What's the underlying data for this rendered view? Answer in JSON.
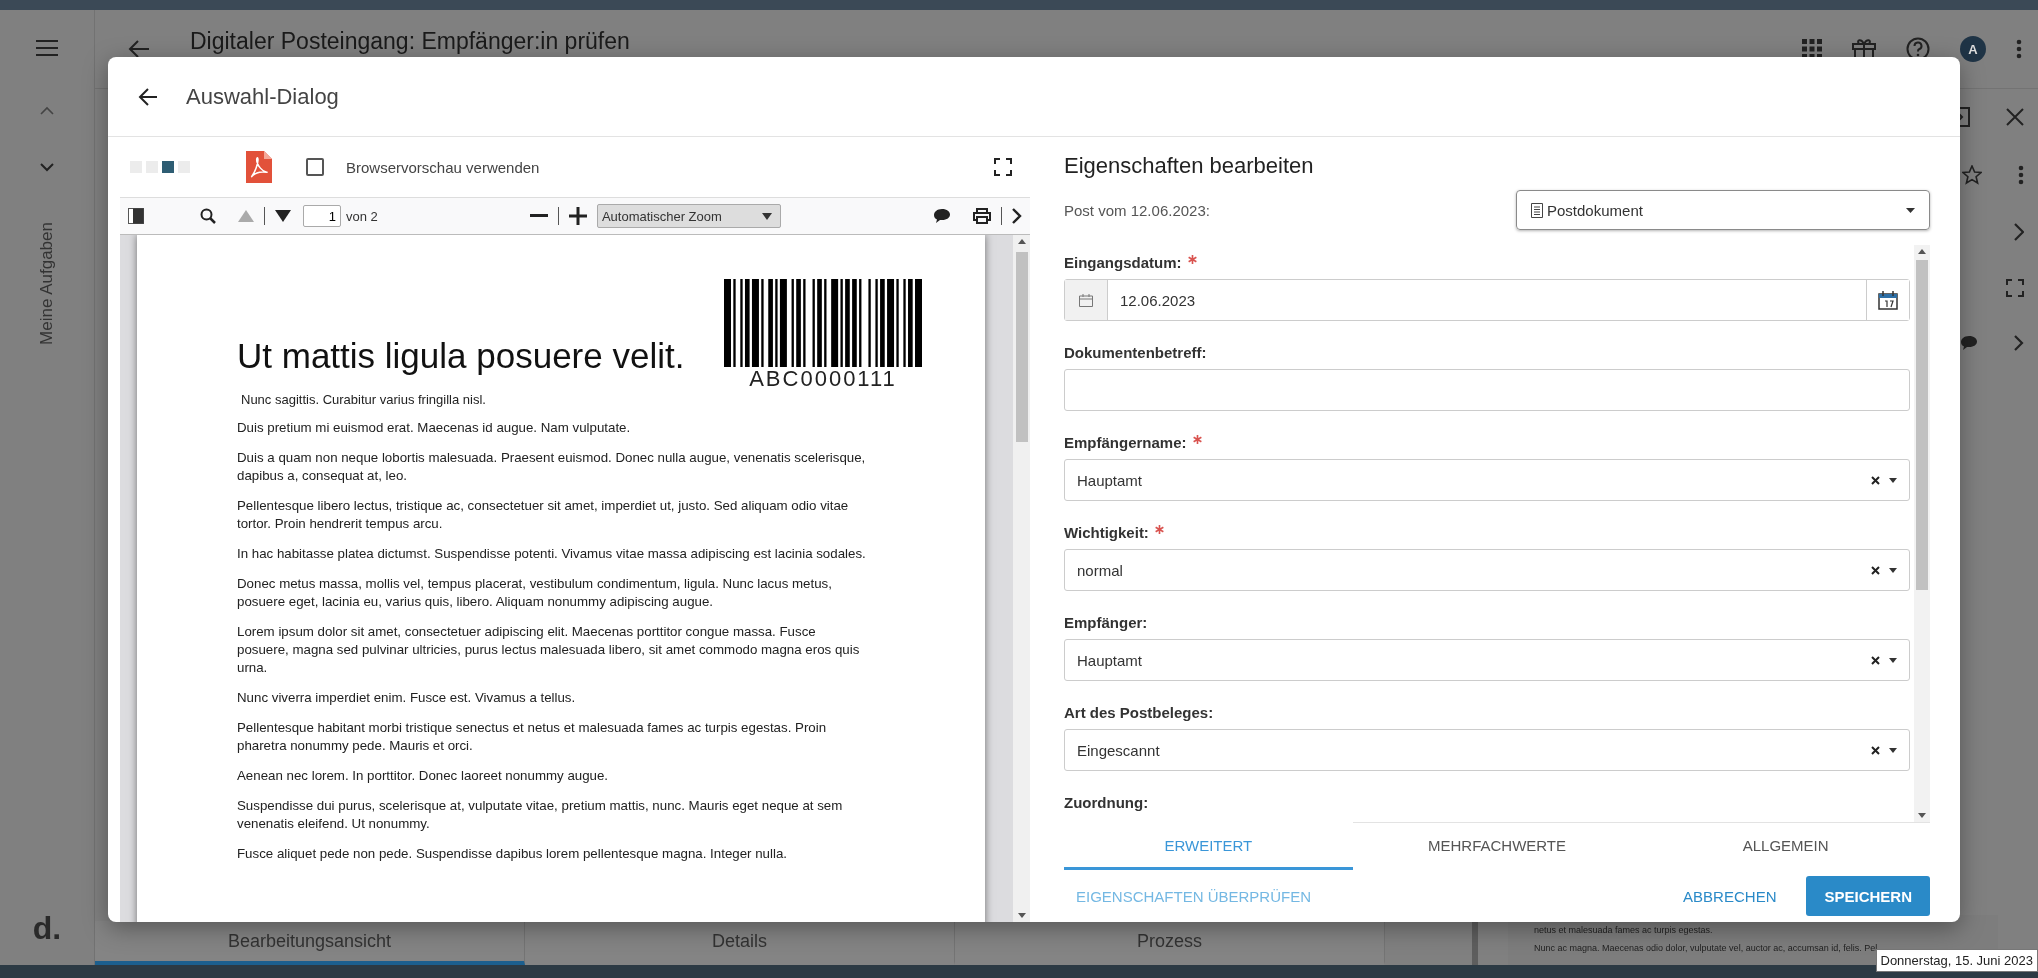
{
  "app": {
    "title": "Digitaler Posteingang: Empfänger:in prüfen",
    "sidebar_label": "Meine Aufgaben",
    "logo": "d.",
    "avatar": "A",
    "bottom_tabs": [
      {
        "label": "Bearbeitungsansicht",
        "selected": true
      },
      {
        "label": "Details",
        "selected": false
      },
      {
        "label": "Prozess",
        "selected": false
      }
    ],
    "background_text": [
      "netus et malesuada fames ac turpis egestas.",
      "Nunc ac magna. Maecenas odio dolor, vulputate vel, auctor ac, accumsan id, felis. Pel"
    ],
    "tooltip": "Donnerstag, 15. Juni 2023"
  },
  "dialog": {
    "title": "Auswahl-Dialog",
    "preview": {
      "browser_preview": {
        "label": "Browservorschau verwenden",
        "checked": false
      },
      "page_number": "1",
      "page_total": "von 2",
      "zoom": "Automatischer Zoom",
      "document": {
        "heading": "Ut mattis ligula posuere velit.",
        "barcode": "ABC0000111",
        "subtitle": "Nunc sagittis. Curabitur varius fringilla nisl.",
        "paragraphs": [
          "Duis pretium mi euismod erat. Maecenas id augue. Nam vulputate.",
          "Duis a quam non neque lobortis malesuada. Praesent euismod. Donec nulla augue, venenatis scelerisque, dapibus a, consequat at, leo.",
          "Pellentesque libero lectus, tristique ac, consectetuer sit amet, imperdiet ut, justo. Sed aliquam odio vitae tortor. Proin hendrerit tempus arcu.",
          "In hac habitasse platea dictumst. Suspendisse potenti. Vivamus vitae massa adipiscing est lacinia sodales.",
          "Donec metus massa, mollis vel, tempus placerat, vestibulum condimentum, ligula. Nunc lacus metus, posuere eget, lacinia eu, varius quis, libero. Aliquam nonummy adipiscing augue.",
          "Lorem ipsum dolor sit amet, consectetuer adipiscing elit. Maecenas porttitor congue massa. Fusce posuere, magna sed pulvinar ultricies, purus lectus malesuada libero, sit amet commodo magna eros quis urna.",
          "Nunc viverra imperdiet enim. Fusce est. Vivamus a tellus.",
          "Pellentesque habitant morbi tristique senectus et netus et malesuada fames ac turpis egestas. Proin pharetra nonummy pede. Mauris et orci.",
          "Aenean nec lorem. In porttitor. Donec laoreet nonummy augue.",
          "Suspendisse dui purus, scelerisque at, vulputate vitae, pretium mattis, nunc. Mauris eget neque at sem venenatis eleifend. Ut nonummy.",
          "Fusce aliquet pede non pede. Suspendisse dapibus lorem pellentesque magna. Integer nulla."
        ]
      }
    },
    "properties": {
      "title": "Eigenschaften bearbeiten",
      "post_label": "Post vom 12.06.2023:",
      "document_type": "Postdokument",
      "fields": [
        {
          "kind": "date",
          "label": "Eingangsdatum:",
          "required": true,
          "value": "12.06.2023"
        },
        {
          "kind": "text",
          "label": "Dokumentenbetreff:",
          "required": false
        },
        {
          "kind": "select",
          "label": "Empfängername:",
          "required": true,
          "value": "Hauptamt"
        },
        {
          "kind": "select",
          "label": "Wichtigkeit:",
          "required": true,
          "value": "normal"
        },
        {
          "kind": "select",
          "label": "Empfänger:",
          "required": false,
          "value": "Hauptamt"
        },
        {
          "kind": "select",
          "label": "Art des Postbeleges:",
          "required": false,
          "value": "Eingescannt"
        }
      ],
      "next_label": "Zuordnung:",
      "tabs": [
        {
          "label": "ERWEITERT",
          "selected": true
        },
        {
          "label": "MEHRFACHWERTE",
          "selected": false
        },
        {
          "label": "ALLGEMEIN",
          "selected": false
        }
      ],
      "actions": [
        {
          "label": "EIGENSCHAFTEN ÜBERPRÜFEN",
          "kind": "link"
        },
        {
          "label": "ABBRECHEN",
          "kind": "text"
        },
        {
          "label": "SPEICHERN",
          "kind": "primary"
        }
      ]
    }
  }
}
